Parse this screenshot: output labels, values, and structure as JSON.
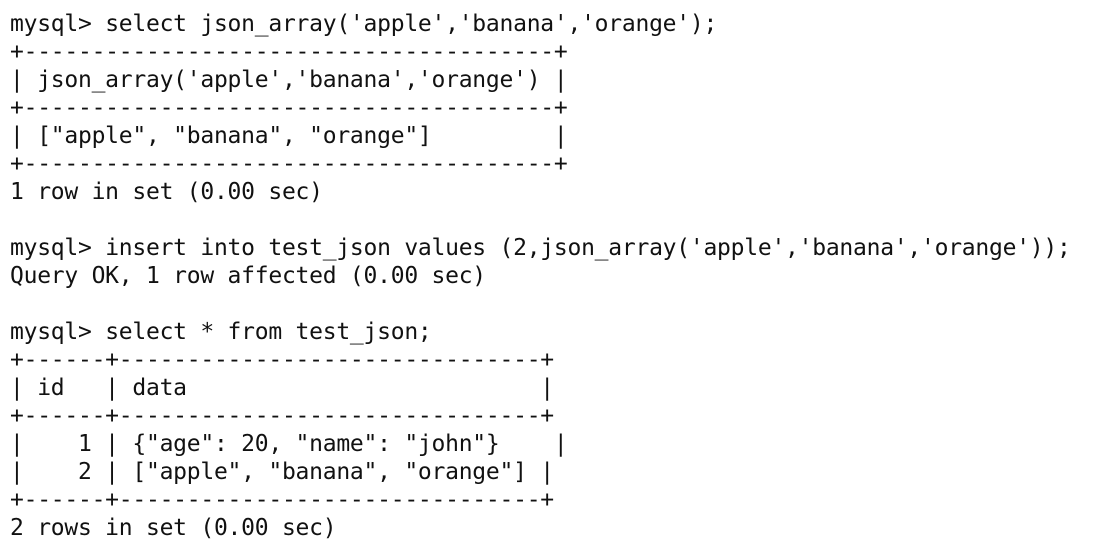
{
  "terminal": {
    "prompt": "mysql> ",
    "block1": {
      "command": "select json_array('apple','banana','orange');",
      "table": [
        "+---------------------------------------+",
        "| json_array('apple','banana','orange') |",
        "+---------------------------------------+",
        "| [\"apple\", \"banana\", \"orange\"]         |",
        "+---------------------------------------+"
      ],
      "result": "1 row in set (0.00 sec)"
    },
    "block2": {
      "command": "insert into test_json values (2,json_array('apple','banana','orange'));",
      "result": "Query OK, 1 row affected (0.00 sec)"
    },
    "block3": {
      "command": "select * from test_json;",
      "table": [
        "+------+-------------------------------+",
        "| id   | data                          |",
        "+------+-------------------------------+",
        "|    1 | {\"age\": 20, \"name\": \"john\"}    |",
        "|    2 | [\"apple\", \"banana\", \"orange\"] |",
        "+------+-------------------------------+"
      ],
      "result": "2 rows in set (0.00 sec)"
    }
  }
}
